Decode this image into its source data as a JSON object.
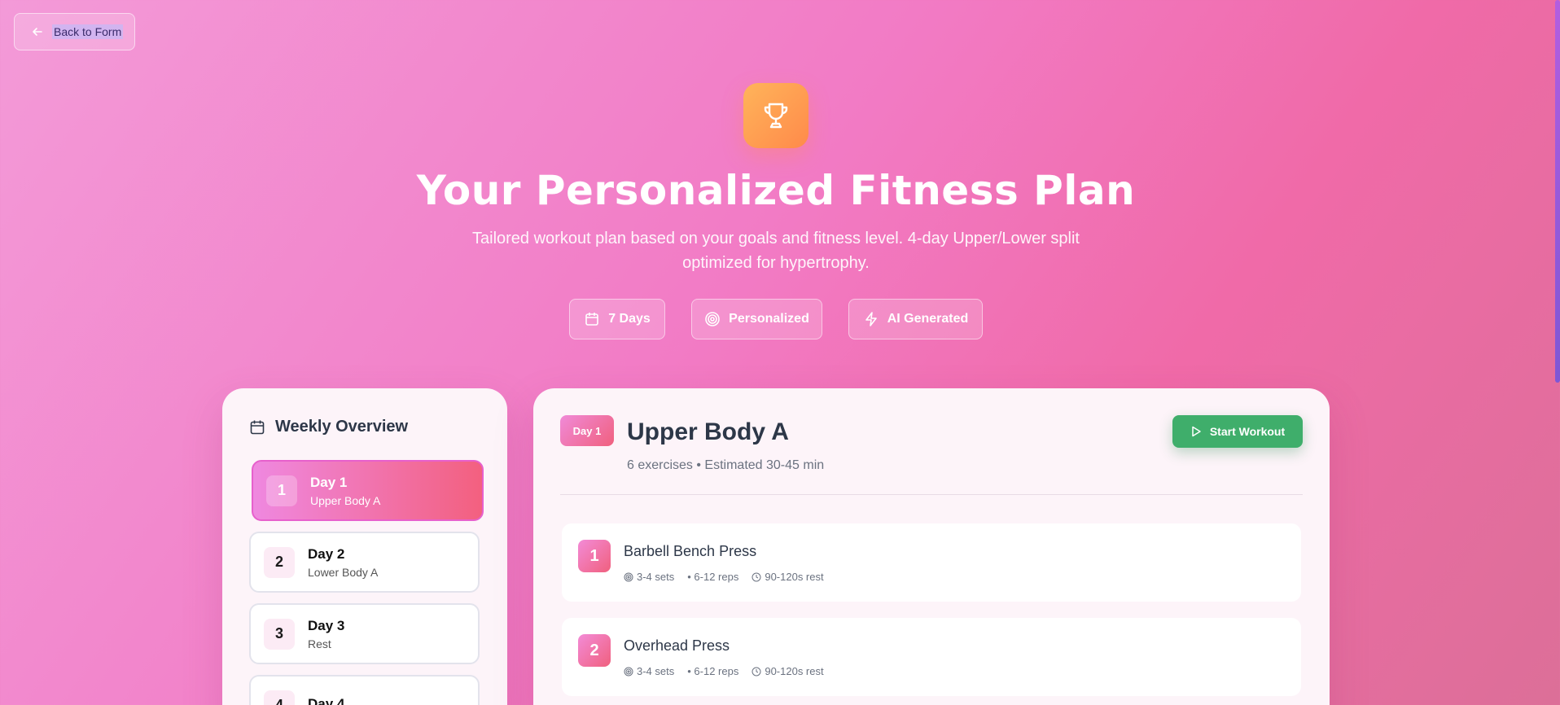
{
  "back_button": {
    "label": "Back to Form"
  },
  "hero": {
    "icon": "trophy-icon",
    "title": "Your Personalized Fitness Plan",
    "subtitle": "Tailored workout plan based on your goals and fitness level. 4-day Upper/Lower split optimized for hypertrophy."
  },
  "pills": [
    {
      "label": "7 Days",
      "icon": "calendar-icon"
    },
    {
      "label": "Personalized",
      "icon": "target-icon"
    },
    {
      "label": "AI Generated",
      "icon": "lightning-icon"
    }
  ],
  "sidebar": {
    "title": "Weekly Overview",
    "days": [
      {
        "num": "1",
        "title": "Day 1",
        "subtitle": "Upper Body A",
        "active": true
      },
      {
        "num": "2",
        "title": "Day 2",
        "subtitle": "Lower Body A"
      },
      {
        "num": "3",
        "title": "Day 3",
        "subtitle": "Rest"
      },
      {
        "num": "4",
        "title": "Day 4",
        "subtitle": ""
      }
    ]
  },
  "main": {
    "badge": "Day 1",
    "title": "Upper Body A",
    "meta": "6 exercises • Estimated 30-45 min",
    "start_button": "Start Workout",
    "exercises": [
      {
        "num": "1",
        "name": "Barbell Bench Press",
        "sets": "3-4 sets",
        "reps": "• 6-12 reps",
        "rest": "90-120s rest"
      },
      {
        "num": "2",
        "name": "Overhead Press",
        "sets": "3-4 sets",
        "reps": "• 6-12 reps",
        "rest": "90-120s rest"
      }
    ]
  },
  "colors": {
    "accent_pink": "#f0607e",
    "start_green": "#3fae6b",
    "hero_icon_orange": "#ff9a4f"
  }
}
